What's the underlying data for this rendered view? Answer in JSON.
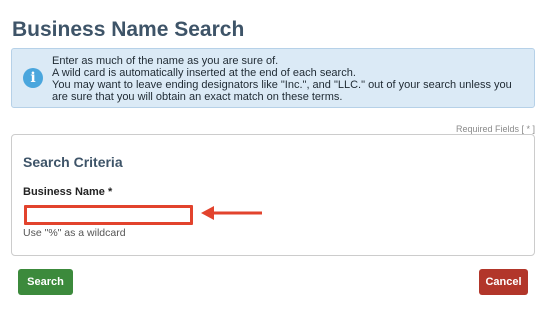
{
  "page": {
    "title": "Business Name Search"
  },
  "info": {
    "icon": "info-icon",
    "icon_glyph": "i",
    "lines": [
      "Enter as much of the name as you are sure of.",
      "A wild card is automatically inserted at the end of each search.",
      "You may want to leave ending designators like \"Inc.\", and \"LLC.\" out of your search unless you",
      "are sure that you will obtain an exact match on these terms."
    ]
  },
  "required_note": "Required Fields [ * ]",
  "criteria": {
    "heading": "Search Criteria",
    "business_name": {
      "label": "Business Name *",
      "value": "",
      "help": "Use \"%\" as a wildcard"
    }
  },
  "annotation": {
    "icon": "arrow-left-icon",
    "color": "#e2432d"
  },
  "actions": {
    "search_label": "Search",
    "cancel_label": "Cancel"
  },
  "colors": {
    "heading": "#3e5468",
    "info_bg": "#dbeaf6",
    "search_button": "#3c8a3c",
    "cancel_button": "#b2362a",
    "highlight": "#e2432d"
  }
}
